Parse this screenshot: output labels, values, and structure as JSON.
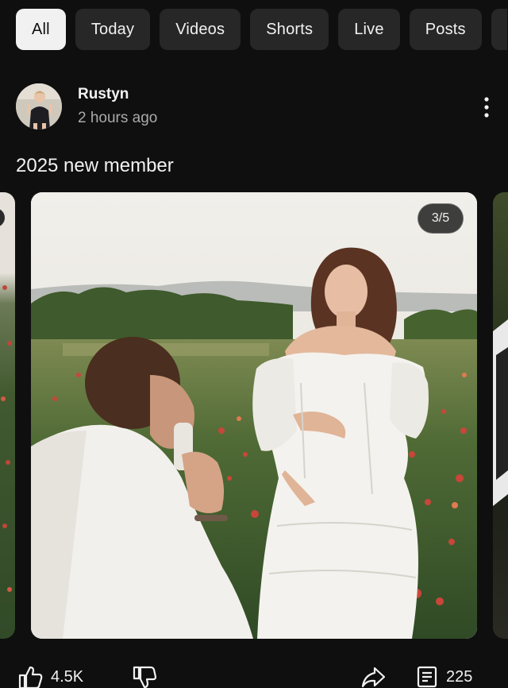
{
  "chips": [
    {
      "label": "All",
      "active": true
    },
    {
      "label": "Today",
      "active": false
    },
    {
      "label": "Videos",
      "active": false
    },
    {
      "label": "Shorts",
      "active": false
    },
    {
      "label": "Live",
      "active": false
    },
    {
      "label": "Posts",
      "active": false
    }
  ],
  "post": {
    "author": "Rustyn",
    "time": "2 hours ago",
    "text": "2025 new member",
    "image_counter": "3/5",
    "likes": "4.5K",
    "comments": "225"
  },
  "icons": {
    "more": "more-vert-icon",
    "like": "thumbs-up-icon",
    "dislike": "thumbs-down-icon",
    "share": "share-icon",
    "comment": "comment-icon"
  },
  "colors": {
    "background": "#0f0f0f",
    "chip_bg": "#272727",
    "chip_active_bg": "#f1f1f1",
    "text_primary": "#f1f1f1",
    "text_secondary": "#aaaaaa"
  }
}
